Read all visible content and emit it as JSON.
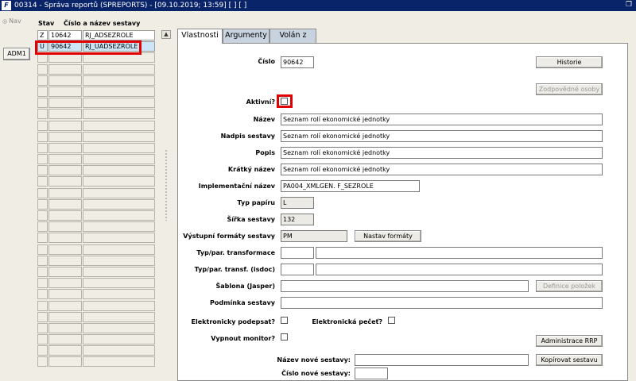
{
  "window": {
    "title": "00314 - Správa reportů (SPREPORTS) - [09.10.2019; 13:59]  [ ]  [ ]",
    "icon": "F"
  },
  "nav": {
    "label": "Nav"
  },
  "sidebar": {
    "adm_button": "ADM1"
  },
  "grid": {
    "headers": {
      "stav": "Stav",
      "cislo_nazev": "Číslo a název sestavy"
    },
    "rows": [
      {
        "stav": "Z",
        "cislo": "10642",
        "nazev": "RJ_ADSEZROLE"
      },
      {
        "stav": "U",
        "cislo": "90642",
        "nazev": "RJ_UADSEZROLE"
      }
    ]
  },
  "tabs": [
    {
      "label": "Vlastnosti"
    },
    {
      "label": "Argumenty"
    },
    {
      "label": "Volán z"
    }
  ],
  "form": {
    "cislo": {
      "label": "Číslo",
      "value": "90642"
    },
    "historie_button": "Historie",
    "zodpovedne_osoby_button": "Zodpovědné osoby",
    "aktivni": {
      "label": "Aktivní?",
      "checked": false
    },
    "nazev": {
      "label": "Název",
      "value": "Seznam rolí ekonomické jednotky"
    },
    "nadpis": {
      "label": "Nadpis sestavy",
      "value": "Seznam rolí ekonomické jednotky"
    },
    "popis": {
      "label": "Popis",
      "value": "Seznam rolí ekonomické jednotky"
    },
    "kratky_nazev": {
      "label": "Krátký název",
      "value": "Seznam rolí ekonomické jednotky"
    },
    "implementacni_nazev": {
      "label": "Implementační název",
      "value": "PA004_XMLGEN. F_SEZROLE"
    },
    "typ_papiru": {
      "label": "Typ papíru",
      "value": "L"
    },
    "sirka_sestavy": {
      "label": "Šířka sestavy",
      "value": "132"
    },
    "vystupni_formaty": {
      "label": "Výstupní formáty sestavy",
      "value": "PM"
    },
    "nastav_formaty_button": "Nastav formáty",
    "typ_par_transformace": {
      "label": "Typ/par. transformace",
      "value": "",
      "value2": ""
    },
    "typ_par_transf_isdoc": {
      "label": "Typ/par. transf. (isdoc)",
      "value": "",
      "value2": ""
    },
    "sablona": {
      "label": "Šablona (Jasper)",
      "value": ""
    },
    "definice_polozek_button": "Definice položek",
    "podminka": {
      "label": "Podmínka sestavy",
      "value": ""
    },
    "elektronicky_podepsat": {
      "label": "Elektronicky podepsat?",
      "checked": false
    },
    "elektronicka_pecet": {
      "label": "Elektronická pečeť?",
      "checked": false
    },
    "vypnout_monitor": {
      "label": "Vypnout monitor?",
      "checked": false
    },
    "administrace_rrp_button": "Administrace RRP",
    "nazev_nove_sestavy": {
      "label": "Název nové sestavy:",
      "value": ""
    },
    "kopirovat_button": "Kopírovat sestavu",
    "cislo_nove_sestavy": {
      "label": "Číslo nové sestavy:",
      "value": ""
    }
  }
}
